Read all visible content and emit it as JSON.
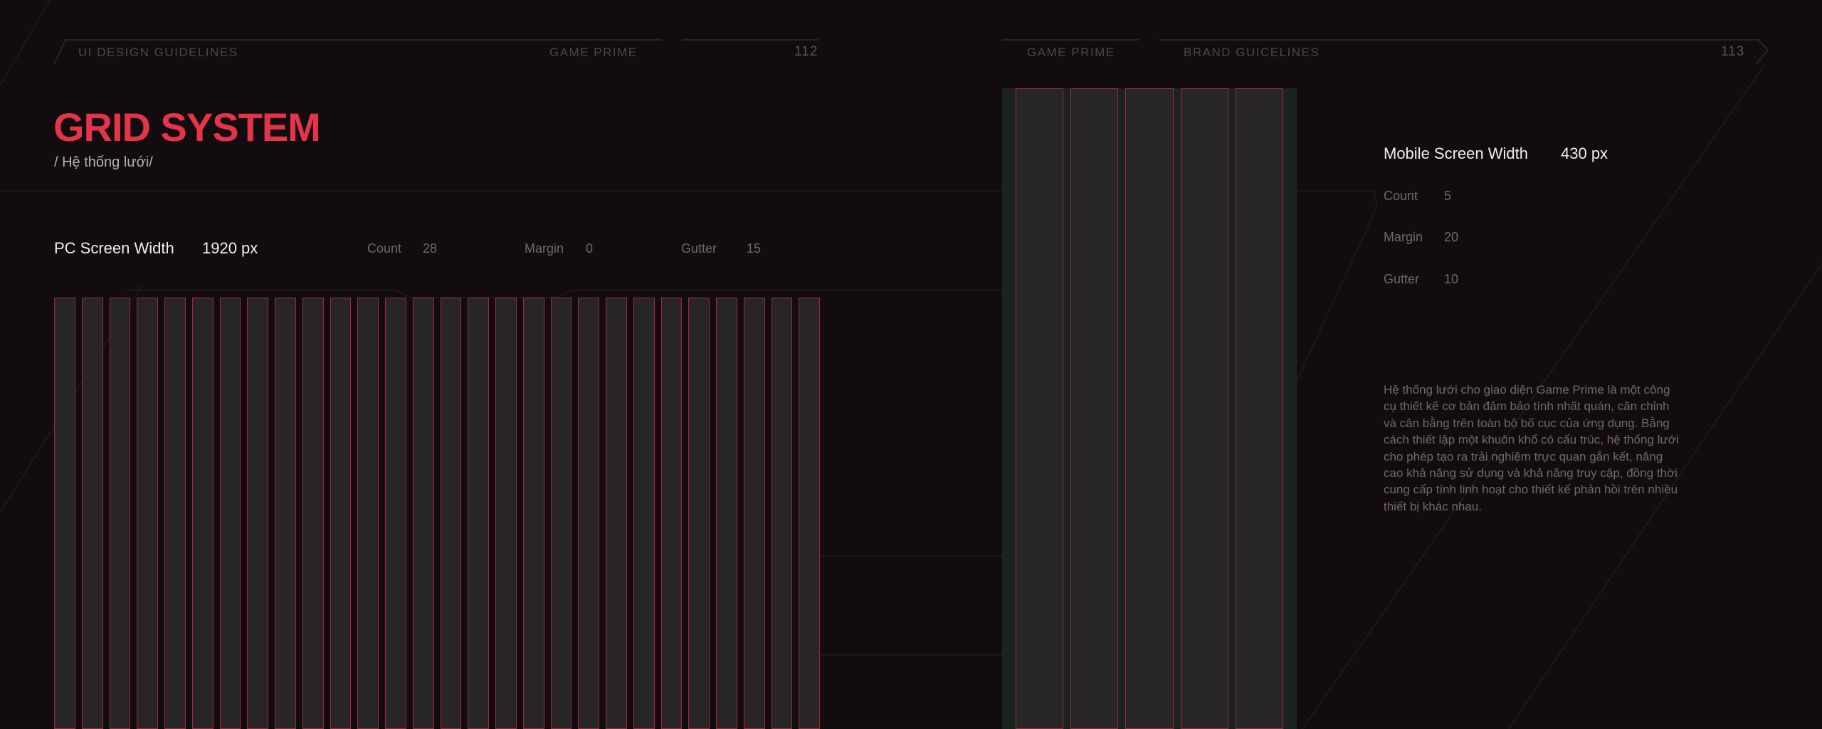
{
  "left_page": {
    "header_left": "UI DESIGN GUIDELINES",
    "header_right": "GAME PRIME",
    "page_number": "112",
    "title": "GRID SYSTEM",
    "subtitle": "/ Hệ thống lưới/",
    "pc": {
      "label": "PC Screen Width",
      "value": "1920 px",
      "count_label": "Count",
      "count": "28",
      "margin_label": "Margin",
      "margin": "0",
      "gutter_label": "Gutter",
      "gutter": "15"
    }
  },
  "right_page": {
    "header_left": "GAME PRIME",
    "header_right": "BRAND GUICELINES",
    "page_number": "113",
    "mobile": {
      "label": "Mobile Screen Width",
      "value": "430 px",
      "count_label": "Count",
      "count": "5",
      "margin_label": "Margin",
      "margin": "20",
      "gutter_label": "Gutter",
      "gutter": "10"
    },
    "description": "Hệ thống lưới cho giao diện Game Prime là một công cụ thiết kế cơ bản đảm bảo tính nhất quán, căn chỉnh và cân bằng trên toàn bộ bố cục của ứng dụng. Bằng cách thiết lập một khuôn khổ có cấu trúc, hệ thống lưới cho phép tạo ra trải nghiệm trực quan gắn kết, nâng cao khả năng sử dụng và khả năng truy cập, đồng thời cung cấp tính linh hoạt cho thiết kế phản hồi trên nhiều thiết bị khác nhau."
  },
  "colors": {
    "background": "#130c0f",
    "accent": "#e5344a",
    "column_fill": "#282527",
    "column_border": "#a3283a",
    "mobile_frame": "#1a2320"
  }
}
